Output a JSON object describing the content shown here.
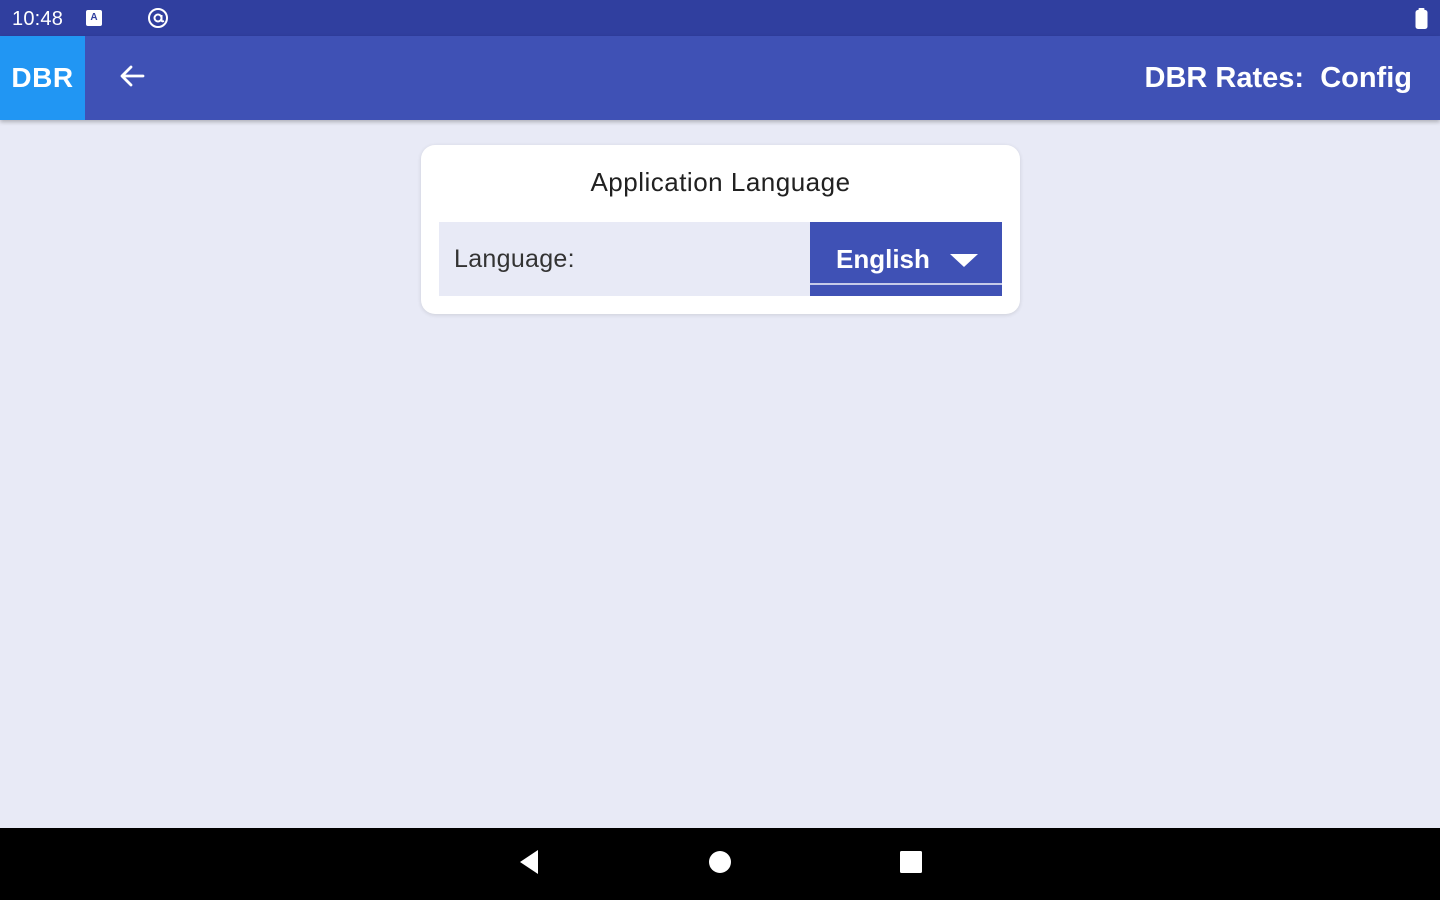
{
  "status_bar": {
    "time": "10:48",
    "icons": [
      "notification-a-icon",
      "at-sign-icon",
      "battery-icon"
    ]
  },
  "app_bar": {
    "brand": "DBR",
    "title": "DBR Rates:  Config",
    "back_icon": "arrow-left-icon"
  },
  "settings_card": {
    "title": "Application Language",
    "language_field": {
      "label": "Language:",
      "selected_value": "English"
    }
  },
  "nav_bar": {
    "icons": [
      "back-triangle-icon",
      "home-circle-icon",
      "recents-square-icon"
    ]
  },
  "colors": {
    "primary": "#3f51b5",
    "primary_dark": "#303f9f",
    "accent": "#2196f3",
    "background": "#e8eaf6",
    "card": "#ffffff"
  }
}
